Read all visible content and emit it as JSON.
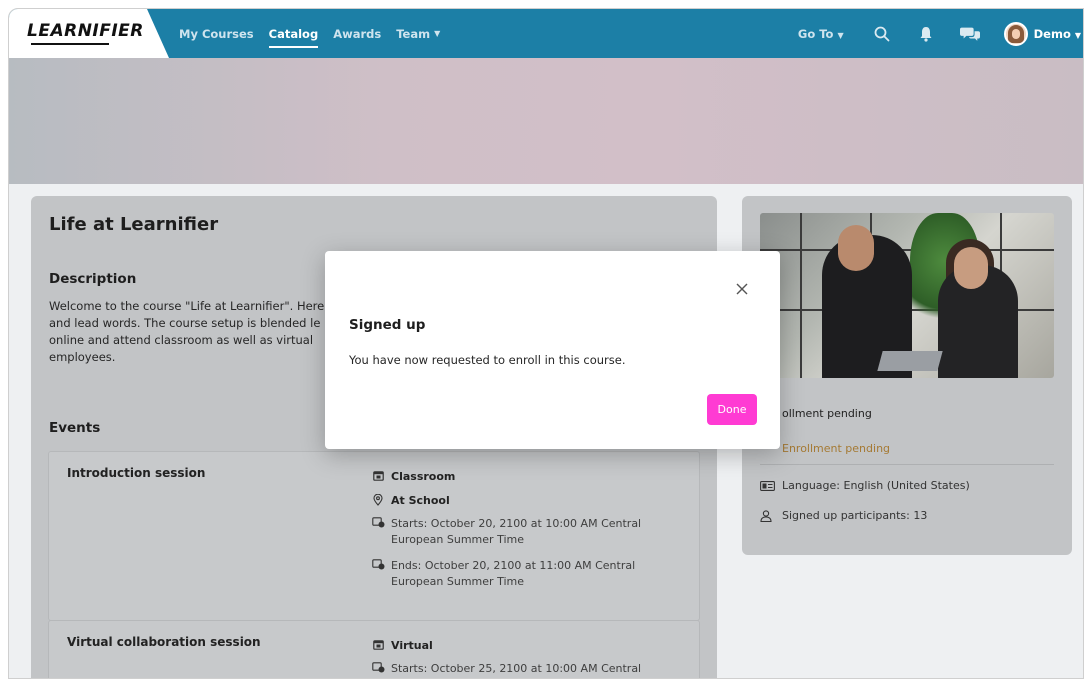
{
  "nav": {
    "logo": "LEARNIFIER",
    "items": [
      {
        "label": "My Courses",
        "active": false,
        "dropdown": false
      },
      {
        "label": "Catalog",
        "active": true,
        "dropdown": false
      },
      {
        "label": "Awards",
        "active": false,
        "dropdown": false
      },
      {
        "label": "Team",
        "active": false,
        "dropdown": true
      }
    ],
    "goto_label": "Go To",
    "user_name": "Demo",
    "icons": [
      "search-icon",
      "bell-icon",
      "chat-icon"
    ]
  },
  "course": {
    "title": "Life at Learnifier",
    "description_heading": "Description",
    "description_text": "Welcome to the course \"Life at Learnifier\". Here and lead words. The course setup is blended le online and attend classroom as well as virtual employees.",
    "events_heading": "Events",
    "events": [
      {
        "name": "Introduction session",
        "type": "Classroom",
        "location": "At School",
        "starts": "Starts: October 20, 2100 at 10:00 AM Central European Summer Time",
        "ends": "Ends: October 20, 2100 at 11:00 AM Central European Summer Time"
      },
      {
        "name": "Virtual collaboration session",
        "type": "Virtual",
        "starts": "Starts: October 25, 2100 at 10:00 AM Central"
      }
    ]
  },
  "sidebar": {
    "enrollment_label": "ollment pending",
    "enrollment_status": "Enrollment pending",
    "language": "Language: English (United States)",
    "participants": "Signed up participants: 13"
  },
  "modal": {
    "title": "Signed up",
    "body": "You have now requested to enroll in this course.",
    "done_label": "Done"
  },
  "colors": {
    "nav_bg": "#1c7fa6",
    "accent_button": "#ff3bd3",
    "pending_text": "#a57a34"
  }
}
